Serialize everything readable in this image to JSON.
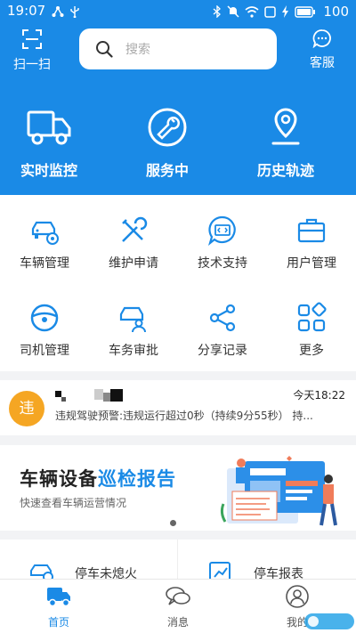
{
  "statusbar": {
    "time": "19:07",
    "battery": "100"
  },
  "header": {
    "scan_label": "扫一扫",
    "service_label": "客服",
    "search_placeholder": "搜索",
    "quick_actions": [
      {
        "label": "实时监控",
        "icon": "truck-icon"
      },
      {
        "label": "服务中",
        "icon": "wrench-icon"
      },
      {
        "label": "历史轨迹",
        "icon": "location-pin-icon"
      }
    ]
  },
  "grid": {
    "items": [
      {
        "label": "车辆管理",
        "icon": "car-gear-icon"
      },
      {
        "label": "维护申请",
        "icon": "tools-icon"
      },
      {
        "label": "技术支持",
        "icon": "code-chat-icon"
      },
      {
        "label": "用户管理",
        "icon": "briefcase-icon"
      },
      {
        "label": "司机管理",
        "icon": "steering-wheel-icon"
      },
      {
        "label": "车务审批",
        "icon": "car-person-icon"
      },
      {
        "label": "分享记录",
        "icon": "share-icon"
      },
      {
        "label": "更多",
        "icon": "more-grid-icon"
      }
    ]
  },
  "alert": {
    "badge": "违",
    "time": "今天18:22",
    "text": "违规驾驶预警:违规运行超过0秒（持续9分55秒） 持..."
  },
  "banner": {
    "title_main": "车辆设备",
    "title_highlight": "巡检报告",
    "subtitle": "快速查看车辆运营情况"
  },
  "reports": [
    {
      "label": "停车未熄火",
      "icon": "car-report-icon"
    },
    {
      "label": "停车报表",
      "icon": "chart-report-icon"
    }
  ],
  "tabs": [
    {
      "label": "首页",
      "icon": "home-truck-icon",
      "active": true
    },
    {
      "label": "消息",
      "icon": "message-icon",
      "active": false
    },
    {
      "label": "我的",
      "icon": "user-icon",
      "active": false
    }
  ],
  "colors": {
    "primary": "#1a8ae6",
    "badge": "#f5a623"
  }
}
